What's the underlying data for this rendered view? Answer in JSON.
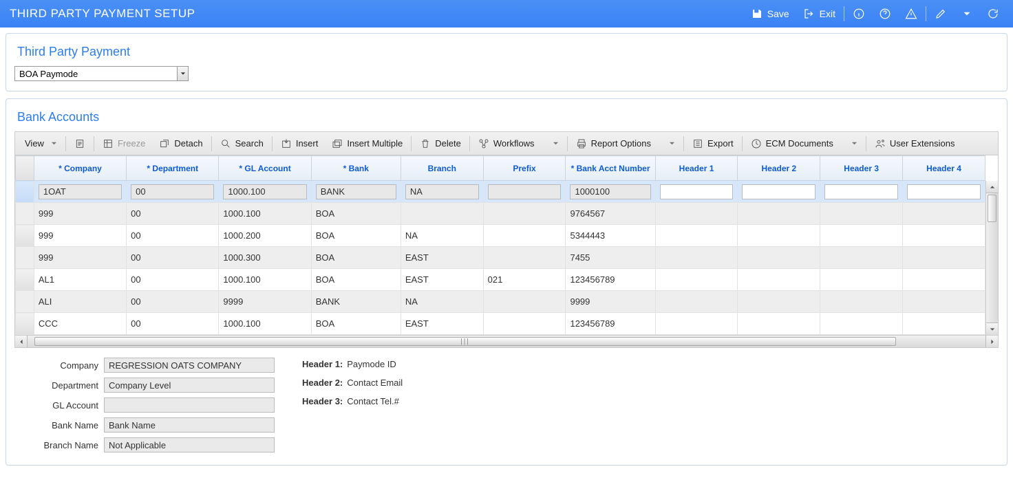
{
  "topbar": {
    "title": "THIRD PARTY PAYMENT SETUP",
    "save": "Save",
    "exit": "Exit"
  },
  "panel1": {
    "title": "Third Party Payment",
    "select_value": "BOA Paymode"
  },
  "panel2": {
    "title": "Bank Accounts"
  },
  "toolbar": {
    "view": "View",
    "freeze": "Freeze",
    "detach": "Detach",
    "search": "Search",
    "insert": "Insert",
    "insert_multiple": "Insert Multiple",
    "delete": "Delete",
    "workflows": "Workflows",
    "report_options": "Report Options",
    "export": "Export",
    "ecm_documents": "ECM Documents",
    "user_extensions": "User Extensions"
  },
  "columns": {
    "company": "* Company",
    "department": "* Department",
    "gl_account": "* GL Account",
    "bank": "* Bank",
    "branch": "Branch",
    "prefix": "Prefix",
    "bank_acct": "* Bank Acct Number",
    "h1": "Header 1",
    "h2": "Header 2",
    "h3": "Header 3",
    "h4": "Header 4"
  },
  "rows": [
    {
      "company": "1OAT",
      "department": "00",
      "gl": "1000.100",
      "bank": "BANK",
      "branch": "NA",
      "prefix": "",
      "acct": "1000100",
      "h1": "",
      "h2": "",
      "h3": "",
      "h4": ""
    },
    {
      "company": "999",
      "department": "00",
      "gl": "1000.100",
      "bank": "BOA",
      "branch": "",
      "prefix": "",
      "acct": "9764567",
      "h1": "",
      "h2": "",
      "h3": "",
      "h4": ""
    },
    {
      "company": "999",
      "department": "00",
      "gl": "1000.200",
      "bank": "BOA",
      "branch": "NA",
      "prefix": "",
      "acct": "5344443",
      "h1": "",
      "h2": "",
      "h3": "",
      "h4": ""
    },
    {
      "company": "999",
      "department": "00",
      "gl": "1000.300",
      "bank": "BOA",
      "branch": "EAST",
      "prefix": "",
      "acct": "7455",
      "h1": "",
      "h2": "",
      "h3": "",
      "h4": ""
    },
    {
      "company": "AL1",
      "department": "00",
      "gl": "1000.100",
      "bank": "BOA",
      "branch": "EAST",
      "prefix": "021",
      "acct": "123456789",
      "h1": "",
      "h2": "",
      "h3": "",
      "h4": ""
    },
    {
      "company": "ALI",
      "department": "00",
      "gl": "9999",
      "bank": "BANK",
      "branch": "NA",
      "prefix": "",
      "acct": "9999",
      "h1": "",
      "h2": "",
      "h3": "",
      "h4": ""
    },
    {
      "company": "CCC",
      "department": "00",
      "gl": "1000.100",
      "bank": "BOA",
      "branch": "EAST",
      "prefix": "",
      "acct": "123456789",
      "h1": "",
      "h2": "",
      "h3": "",
      "h4": ""
    }
  ],
  "detail": {
    "labels": {
      "company": "Company",
      "department": "Department",
      "gl_account": "GL Account",
      "bank_name": "Bank Name",
      "branch_name": "Branch Name"
    },
    "values": {
      "company": "REGRESSION OATS COMPANY",
      "department": "Company Level",
      "gl_account": "",
      "bank_name": "Bank Name",
      "branch_name": "Not Applicable"
    },
    "headers": {
      "h1l": "Header 1:",
      "h1v": "Paymode ID",
      "h2l": "Header 2:",
      "h2v": "Contact Email",
      "h3l": "Header 3:",
      "h3v": "Contact Tel.#"
    }
  }
}
